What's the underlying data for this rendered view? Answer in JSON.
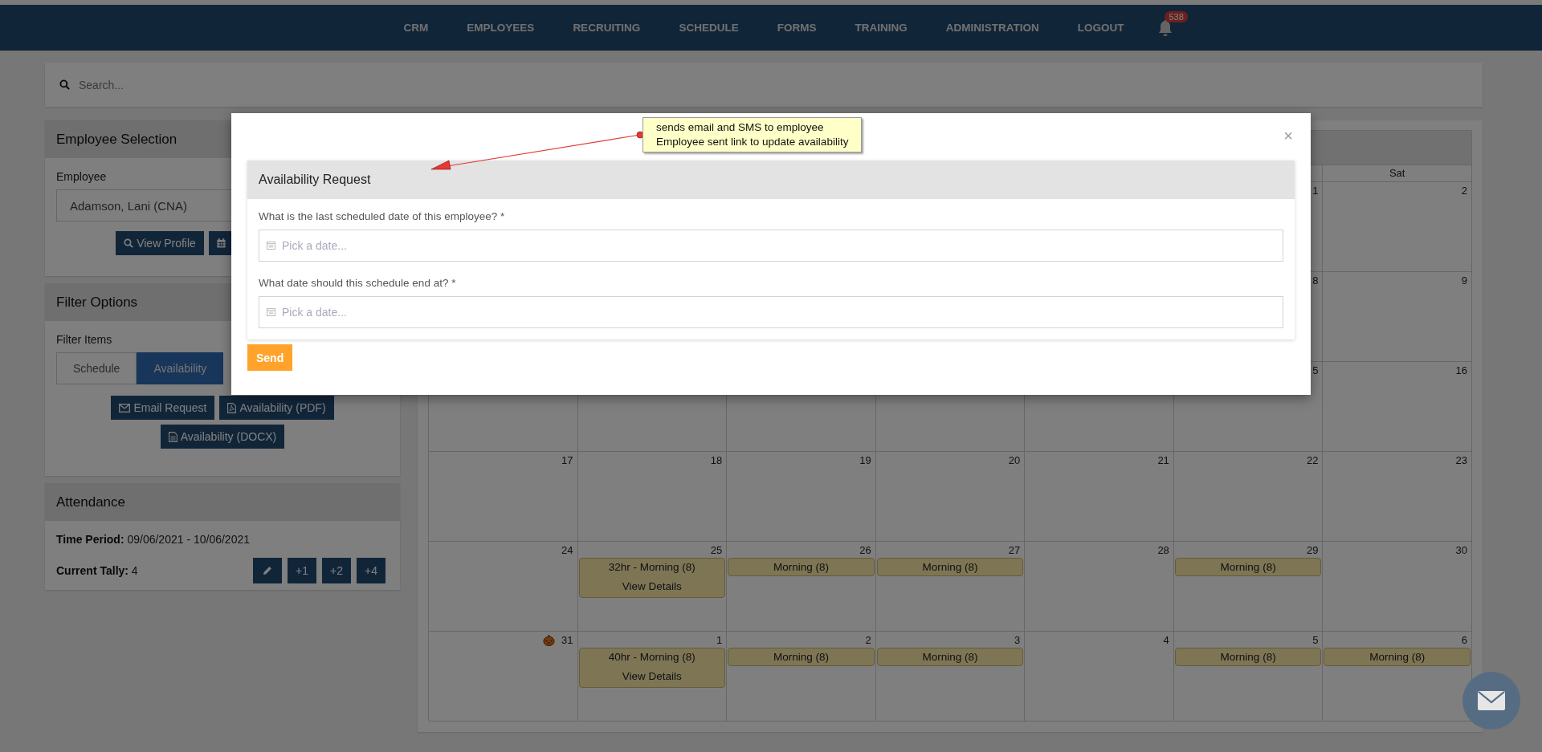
{
  "nav": {
    "items": [
      "CRM",
      "EMPLOYEES",
      "RECRUITING",
      "SCHEDULE",
      "FORMS",
      "TRAINING",
      "ADMINISTRATION",
      "LOGOUT"
    ],
    "notifications": "538"
  },
  "search": {
    "placeholder": "Search..."
  },
  "employee_selection": {
    "title": "Employee Selection",
    "label": "Employee",
    "value": "Adamson, Lani (CNA)",
    "profile_button": "View Profile"
  },
  "filter_options": {
    "title": "Filter Options",
    "label": "Filter Items",
    "segments": [
      {
        "label": "Schedule",
        "selected": false
      },
      {
        "label": "Availability",
        "selected": true
      }
    ],
    "buttons": [
      {
        "kind": "email",
        "label": "Email Request"
      },
      {
        "kind": "pdf",
        "label": "Availability (PDF)"
      },
      {
        "kind": "doc",
        "label": "Availability (DOCX)"
      }
    ]
  },
  "attendance": {
    "title": "Attendance",
    "fields": [
      {
        "label": "Time Period:",
        "value": "09/06/2021 - 10/06/2021"
      },
      {
        "label": "Current Tally:",
        "value": "4"
      }
    ],
    "buttons": [
      {
        "kind": "edit"
      },
      {
        "kind": "text",
        "label": "+1"
      },
      {
        "kind": "text",
        "label": "+2"
      },
      {
        "kind": "text",
        "label": "+4"
      }
    ]
  },
  "calendar": {
    "day_headers": [
      "Sat"
    ],
    "weeks": [
      [
        {
          "day": "1"
        },
        {
          "day": "2"
        }
      ],
      [
        {
          "day": "8"
        },
        {
          "day": "9"
        }
      ],
      [
        {
          "day": "5"
        },
        {
          "day": "16"
        }
      ],
      [
        {
          "day": "17"
        },
        {
          "day": "18"
        },
        {
          "day": "19"
        },
        {
          "day": "20"
        },
        {
          "day": "21"
        },
        {
          "day": "22"
        },
        {
          "day": "23"
        }
      ],
      [
        {
          "day": "24"
        },
        {
          "day": "25",
          "events": [
            {
              "title": "32hr - Morning (8)",
              "details": "View Details"
            }
          ]
        },
        {
          "day": "26",
          "events": [
            {
              "title": "Morning (8)"
            }
          ]
        },
        {
          "day": "27",
          "events": [
            {
              "title": "Morning (8)"
            }
          ]
        },
        {
          "day": "28"
        },
        {
          "day": "29",
          "events": [
            {
              "title": "Morning (8)"
            }
          ]
        },
        {
          "day": "30"
        }
      ],
      [
        {
          "day": "31",
          "holiday": true
        },
        {
          "day": "1",
          "events": [
            {
              "title": "40hr - Morning (8)",
              "details": "View Details"
            }
          ]
        },
        {
          "day": "2",
          "events": [
            {
              "title": "Morning (8)"
            }
          ]
        },
        {
          "day": "3",
          "events": [
            {
              "title": "Morning (8)"
            }
          ]
        },
        {
          "day": "4"
        },
        {
          "day": "5",
          "events": [
            {
              "title": "Morning (8)"
            }
          ]
        },
        {
          "day": "6",
          "events": [
            {
              "title": "Morning (8)"
            }
          ]
        }
      ]
    ]
  },
  "modal": {
    "close": "×",
    "title": "Availability Request",
    "fields": [
      {
        "label": "What is the last scheduled date of this employee? *",
        "placeholder": "Pick a date..."
      },
      {
        "label": "What date should this schedule end at? *",
        "placeholder": "Pick a date..."
      }
    ],
    "submit": "Send"
  },
  "annotation": {
    "lines": [
      "sends email and SMS to employee",
      "Employee sent link to update availability"
    ]
  }
}
